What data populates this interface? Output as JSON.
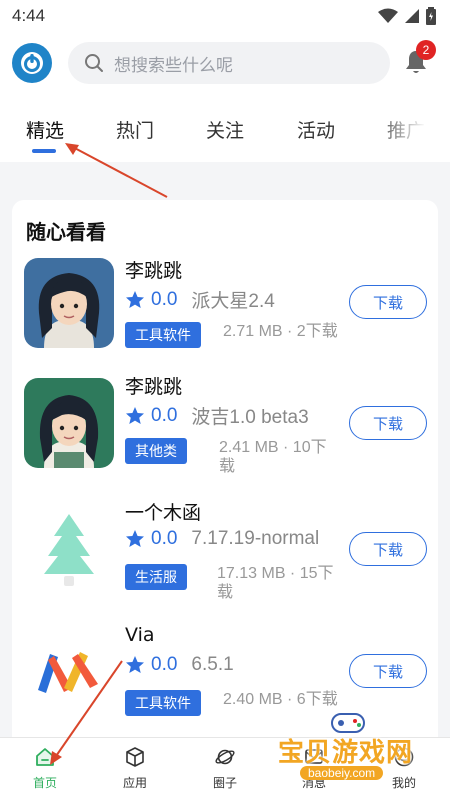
{
  "status": {
    "time": "4:44"
  },
  "search": {
    "placeholder": "想搜索些什么呢"
  },
  "notifications": {
    "count": "2"
  },
  "tabs": [
    {
      "label": "精选",
      "active": true
    },
    {
      "label": "热门"
    },
    {
      "label": "关注"
    },
    {
      "label": "活动"
    },
    {
      "label": "推广"
    }
  ],
  "section": {
    "title": "随心看看"
  },
  "apps": [
    {
      "name": "李跳跳",
      "rating": "0.0",
      "version": "派大星2.4",
      "tag": "工具软件",
      "meta_line1": "2.71 MB · 2下载",
      "meta_line2": "",
      "download": "下载"
    },
    {
      "name": "李跳跳",
      "rating": "0.0",
      "version": "波吉1.0 beta3",
      "tag": "其他类",
      "meta_line1": "2.41 MB · 10下",
      "meta_line2": "载",
      "download": "下载"
    },
    {
      "name": "一个木函",
      "rating": "0.0",
      "version": "7.17.19-normal",
      "tag": "生活服",
      "meta_line1": "17.13 MB · 15下",
      "meta_line2": "载",
      "download": "下载"
    },
    {
      "name": "Via",
      "rating": "0.0",
      "version": "6.5.1",
      "tag": "工具软件",
      "meta_line1": "2.40 MB · 6下载",
      "meta_line2": "",
      "download": "下载"
    }
  ],
  "nav": [
    {
      "label": "首页",
      "icon": "home-icon",
      "active": true
    },
    {
      "label": "应用",
      "icon": "box-icon"
    },
    {
      "label": "圈子",
      "icon": "planet-icon"
    },
    {
      "label": "消息",
      "icon": "message-icon"
    },
    {
      "label": "我的",
      "icon": "profile-icon"
    }
  ],
  "watermark": {
    "text": "宝贝游戏网",
    "url": "baobeiy.com"
  },
  "colors": {
    "accent": "#2f6fde",
    "nav_active": "#2fae5e",
    "badge": "#e02424",
    "annotation": "#d9462b"
  }
}
